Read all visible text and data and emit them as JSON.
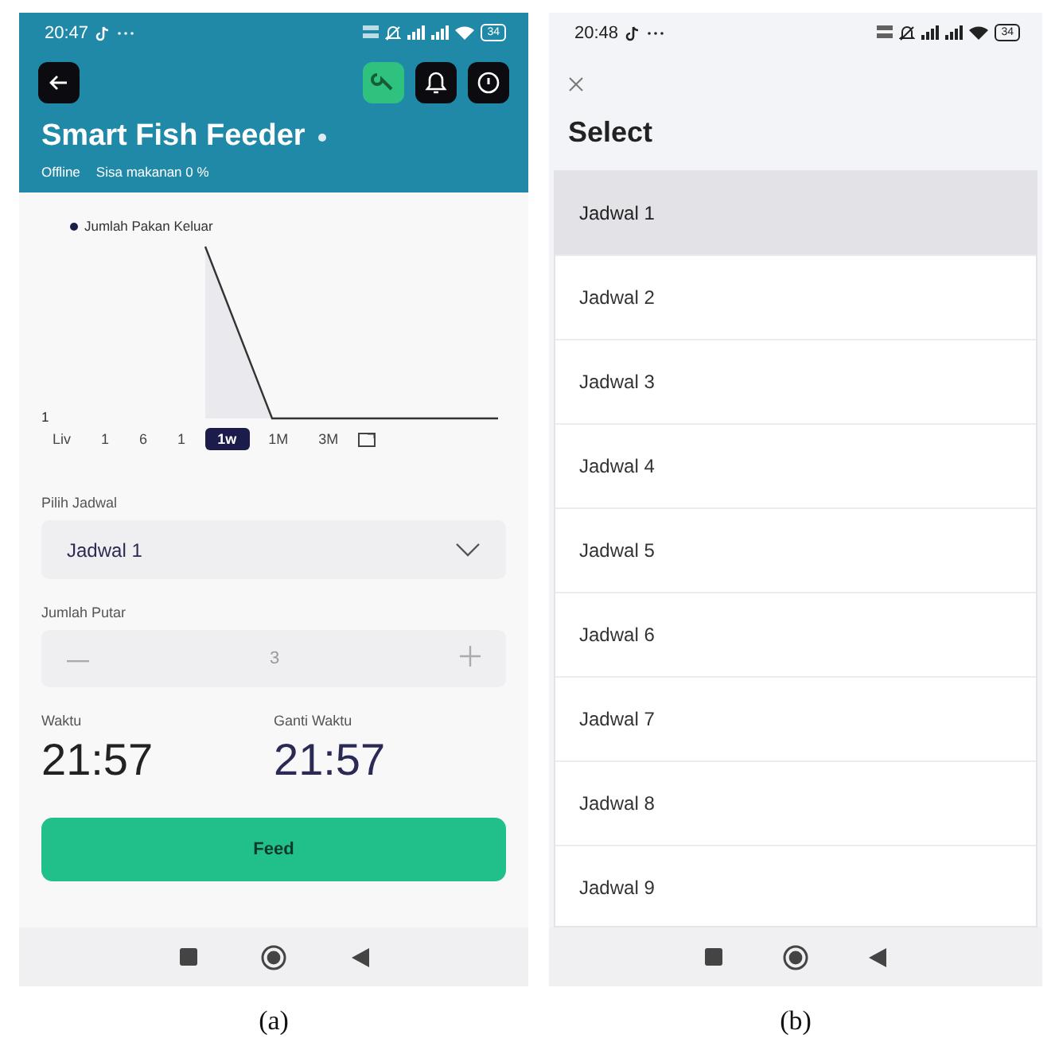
{
  "screen_a": {
    "status_bar": {
      "time": "20:47",
      "battery": "34"
    },
    "header": {
      "buttons": [
        {
          "kind": "back"
        },
        {
          "kind": "wrench"
        },
        {
          "kind": "bell"
        },
        {
          "kind": "info"
        }
      ],
      "title": "Smart Fish Feeder",
      "connection": "Offline",
      "food_left": "Sisa makanan 0 %"
    },
    "chart": {
      "legend": "Jumlah Pakan Keluar",
      "y_tick": "1",
      "ranges": [
        {
          "label": "Liv",
          "selected": false
        },
        {
          "label": "1",
          "selected": false
        },
        {
          "label": "6",
          "selected": false
        },
        {
          "label": "1",
          "selected": false
        },
        {
          "label": "1w",
          "selected": true
        },
        {
          "label": "1M",
          "selected": false
        },
        {
          "label": "3M",
          "selected": false
        }
      ]
    },
    "schedule": {
      "label": "Pilih Jadwal",
      "value": "Jadwal 1"
    },
    "turns": {
      "label": "Jumlah Putar",
      "value": "3"
    },
    "times": [
      {
        "label": "Waktu",
        "value": "21:57"
      },
      {
        "label": "Ganti Waktu",
        "value": "21:57"
      }
    ],
    "feed_button": "Feed"
  },
  "screen_b": {
    "status_bar": {
      "time": "20:48",
      "battery": "34"
    },
    "title": "Select",
    "items": [
      {
        "label": "Jadwal 1",
        "selected": true
      },
      {
        "label": "Jadwal 2",
        "selected": false
      },
      {
        "label": "Jadwal 3",
        "selected": false
      },
      {
        "label": "Jadwal 4",
        "selected": false
      },
      {
        "label": "Jadwal 5",
        "selected": false
      },
      {
        "label": "Jadwal 6",
        "selected": false
      },
      {
        "label": "Jadwal 7",
        "selected": false
      },
      {
        "label": "Jadwal 8",
        "selected": false
      },
      {
        "label": "Jadwal 9",
        "selected": false
      }
    ]
  },
  "captions": [
    "(a)",
    "(b)"
  ]
}
